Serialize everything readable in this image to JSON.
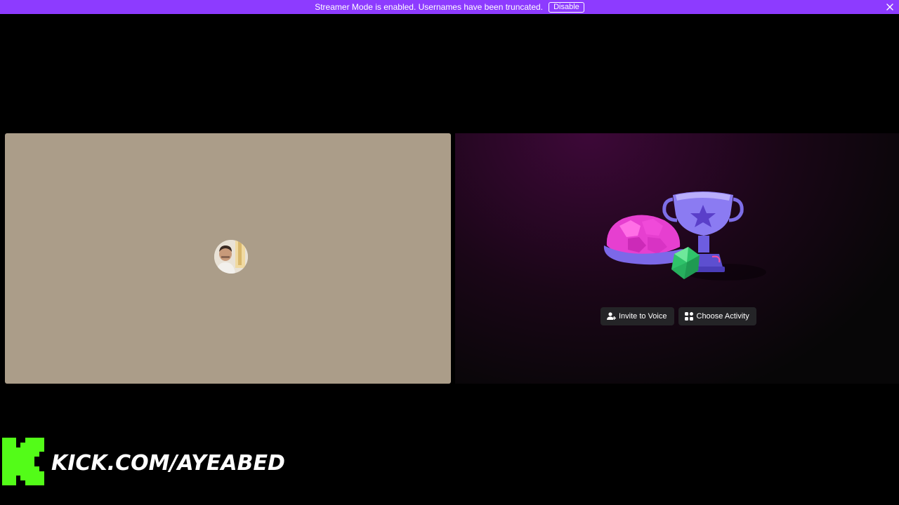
{
  "banner": {
    "message": "Streamer Mode is enabled. Usernames have been truncated.",
    "disable_label": "Disable",
    "close_icon": "close-icon",
    "color": "#8d3bff"
  },
  "participant": {
    "tile_color": "#ab9d89",
    "avatar_icon": "user-avatar"
  },
  "activity": {
    "art_icon": "trophy-dice-illustration",
    "invite_label": "Invite to Voice",
    "invite_icon": "add-user-icon",
    "choose_label": "Choose Activity",
    "choose_icon": "activity-grid-icon",
    "button_color": "#242427"
  },
  "watermark": {
    "text": "KICK.COM/AYEABED",
    "logo_icon": "kick-logo-icon",
    "logo_color": "#53fc18"
  }
}
